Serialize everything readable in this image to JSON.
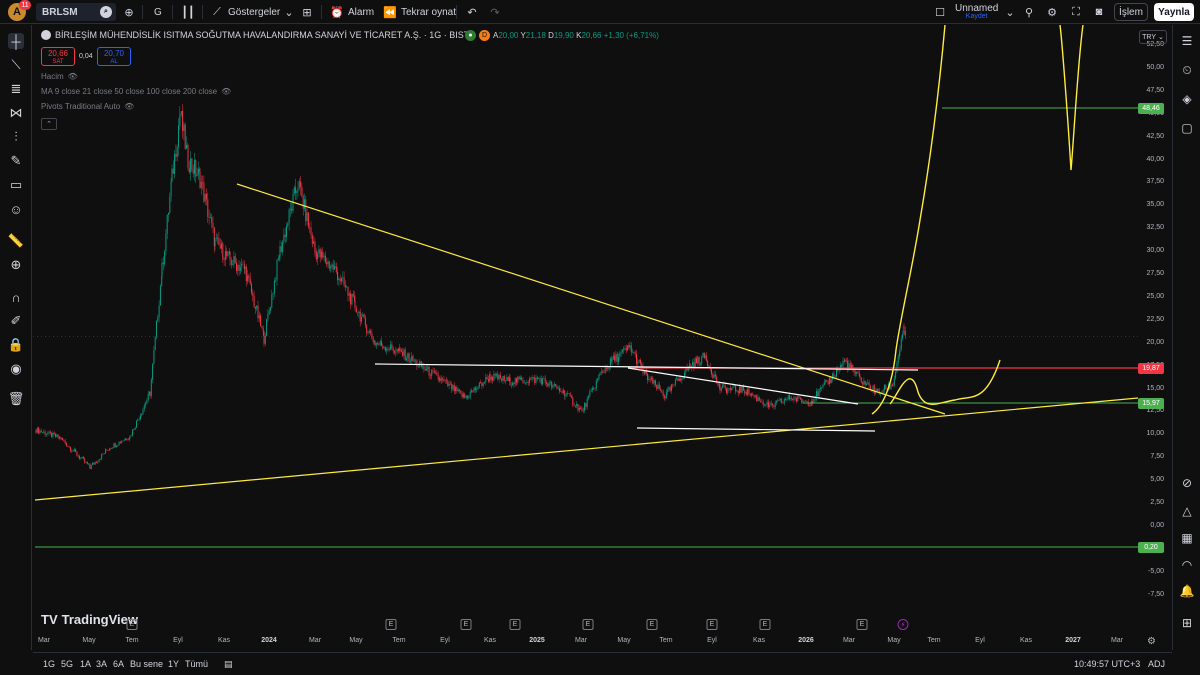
{
  "topbar": {
    "avatar_letter": "A",
    "avatar_badge": "11",
    "symbol": "BRLSM",
    "interval": "G",
    "indicators_label": "Göstergeler",
    "alarm_label": "Alarm",
    "replay_label": "Tekrar oynat",
    "layout_name": "Unnamed",
    "save_label": "Kaydet",
    "trade_label": "İşlem",
    "publish_label": "Yaynla"
  },
  "legend": {
    "title": "BİRLEŞİM MÜHENDİSLİK ISITMA SOĞUTMA HAVALANDIRMA SANAYİ VE TİCARET A.Ş. · 1G · BIST",
    "d_badge": "D",
    "open_key": "A",
    "open_val": "20,00",
    "high_key": "Y",
    "high_val": "21,18",
    "low_key": "D",
    "low_val": "19,90",
    "close_key": "K",
    "close_val": "20,66",
    "change": "+1,30 (+6,71%)",
    "sell_price": "20,66",
    "sell_label": "SAT",
    "spread": "0,04",
    "buy_price": "20,70",
    "buy_label": "AL",
    "indicator_volume": "Hacim",
    "indicator_ma": "MA 9 close 21 close 50 close 100 close 200 close",
    "indicator_pivots": "Pivots Traditional Auto"
  },
  "currency": "TRY",
  "price_axis": [
    "52,50",
    "50,00",
    "47,50",
    "45,00",
    "42,50",
    "40,00",
    "37,50",
    "35,00",
    "32,50",
    "30,00",
    "27,50",
    "25,00",
    "22,50",
    "20,00",
    "17,50",
    "15,00",
    "12,50",
    "10,00",
    "7,50",
    "5,00",
    "2,50",
    "0,00",
    "-2,50",
    "-5,00",
    "-7,50"
  ],
  "price_tags": [
    {
      "value": "48,46",
      "color": "#4caf50"
    },
    {
      "value": "19,87",
      "color": "#f23645"
    },
    {
      "value": "15,97",
      "color": "#4caf50"
    },
    {
      "value": "0,20",
      "color": "#4caf50"
    }
  ],
  "time_axis": [
    {
      "label": "Mar",
      "bold": false
    },
    {
      "label": "May",
      "bold": false
    },
    {
      "label": "Tem",
      "bold": false
    },
    {
      "label": "Eyl",
      "bold": false
    },
    {
      "label": "Kas",
      "bold": false
    },
    {
      "label": "2024",
      "bold": true
    },
    {
      "label": "Mar",
      "bold": false
    },
    {
      "label": "May",
      "bold": false
    },
    {
      "label": "Tem",
      "bold": false
    },
    {
      "label": "Eyl",
      "bold": false
    },
    {
      "label": "Kas",
      "bold": false
    },
    {
      "label": "2025",
      "bold": true
    },
    {
      "label": "Mar",
      "bold": false
    },
    {
      "label": "May",
      "bold": false
    },
    {
      "label": "Tem",
      "bold": false
    },
    {
      "label": "Eyl",
      "bold": false
    },
    {
      "label": "Kas",
      "bold": false
    },
    {
      "label": "2026",
      "bold": true
    },
    {
      "label": "Mar",
      "bold": false
    },
    {
      "label": "May",
      "bold": false
    },
    {
      "label": "Tem",
      "bold": false
    },
    {
      "label": "Eyl",
      "bold": false
    },
    {
      "label": "Kas",
      "bold": false
    },
    {
      "label": "2027",
      "bold": true
    },
    {
      "label": "Mar",
      "bold": false
    }
  ],
  "event_marker": "E",
  "brand": "TradingView",
  "bottombar": {
    "ranges": [
      "1G",
      "5G",
      "1A",
      "3A",
      "6A",
      "Bu sene",
      "1Y",
      "Tümü"
    ],
    "clock": "10:49:57 UTC+3",
    "adj": "ADJ"
  }
}
